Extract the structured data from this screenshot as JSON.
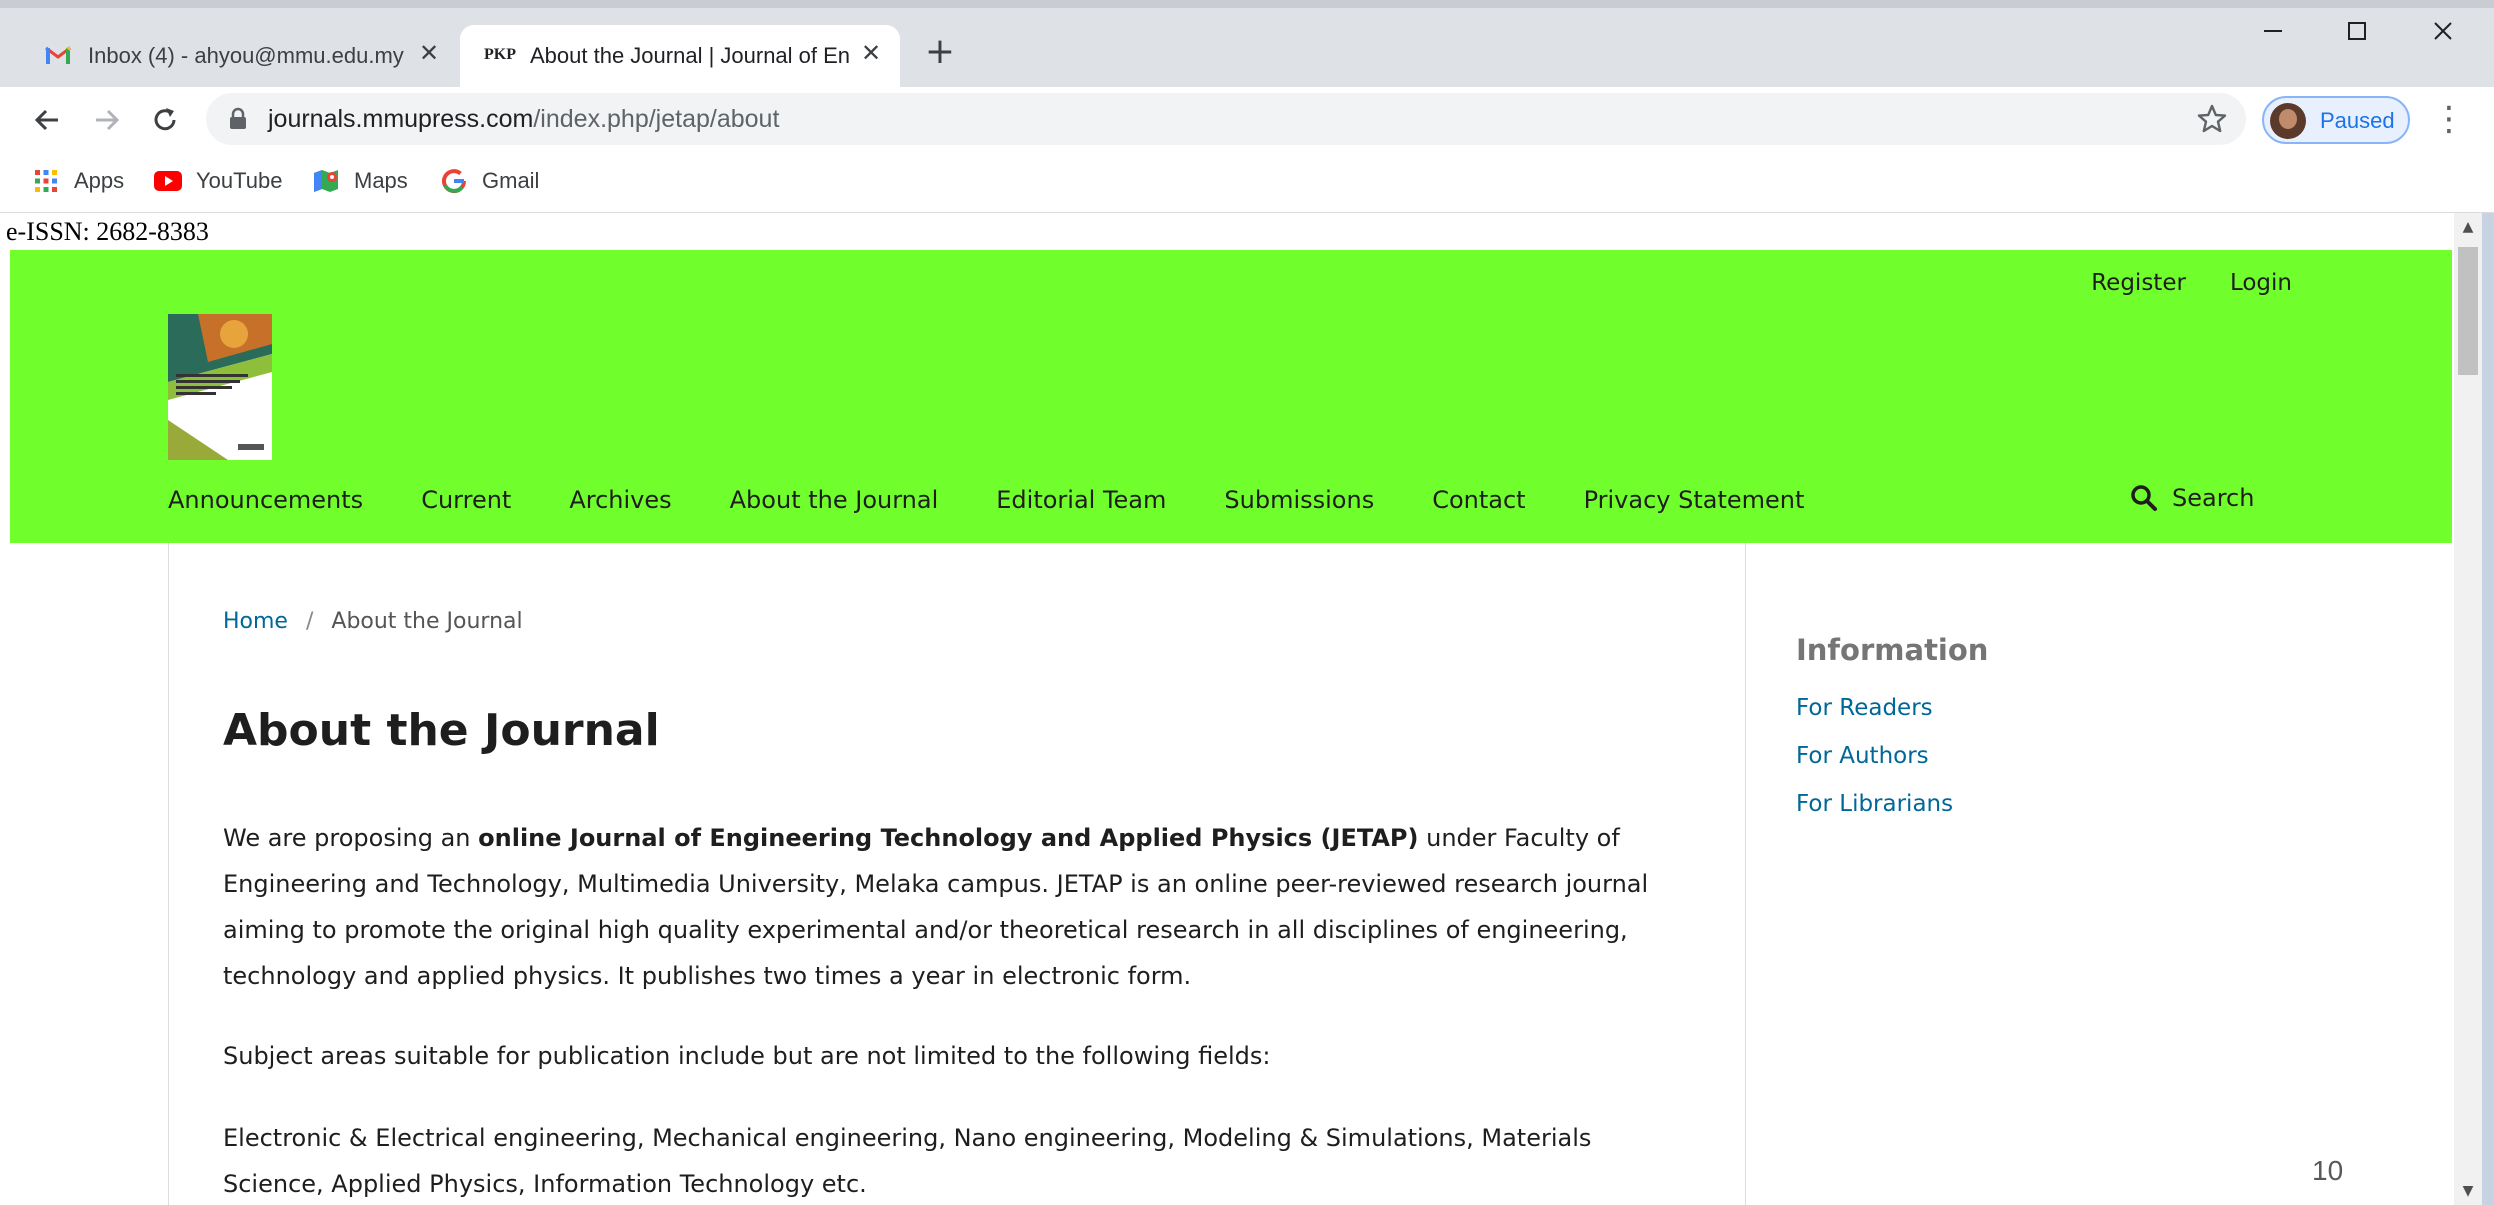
{
  "browser": {
    "tabs": [
      {
        "title": "Inbox (4) - ahyou@mmu.edu.my",
        "favicon": "gmail-icon"
      },
      {
        "title": "About the Journal | Journal of Engineering Technology and Applied Physics",
        "favicon_text": "PKP"
      }
    ],
    "close_glyph": "✕",
    "new_tab_glyph": "+",
    "url_host": "journals.mmupress.com",
    "url_path": "/index.php/jetap/about",
    "profile_status": "Paused",
    "bookmarks": [
      {
        "label": "Apps",
        "icon": "apps-grid-icon"
      },
      {
        "label": "YouTube",
        "icon": "youtube-icon"
      },
      {
        "label": "Maps",
        "icon": "maps-icon"
      },
      {
        "label": "Gmail",
        "icon": "google-icon"
      }
    ]
  },
  "page": {
    "eissn": "e-ISSN: 2682-8383",
    "header_color": "#70ff2d",
    "user_links": {
      "register": "Register",
      "login": "Login"
    },
    "nav": [
      "Announcements",
      "Current",
      "Archives",
      "About the Journal",
      "Editorial Team",
      "Submissions",
      "Contact",
      "Privacy Statement"
    ],
    "search_label": "Search",
    "breadcrumb": {
      "home": "Home",
      "separator": "/",
      "current": "About the Journal"
    },
    "title": "About the Journal",
    "intro_pre": "We are proposing an ",
    "intro_bold": "online Journal of Engineering Technology and Applied Physics (JETAP)",
    "intro_post": " under Faculty of Engineering and Technology, Multimedia University, Melaka campus. JETAP is an online peer-reviewed research journal aiming to promote the original high quality experimental and/or theoretical research in all disciplines of engineering, technology and applied physics. It publishes two times a year in electronic form.",
    "subjects_intro": "Subject areas suitable for publication include but are not limited to the following fields:",
    "subjects": "Electronic & Electrical engineering, Mechanical engineering, Nano engineering, Modeling & Simulations, Materials Science, Applied Physics, Information Technology etc.",
    "sidebar": {
      "title": "Information",
      "links": [
        "For Readers",
        "For Authors",
        "For Librarians"
      ]
    },
    "page_number": "10"
  }
}
